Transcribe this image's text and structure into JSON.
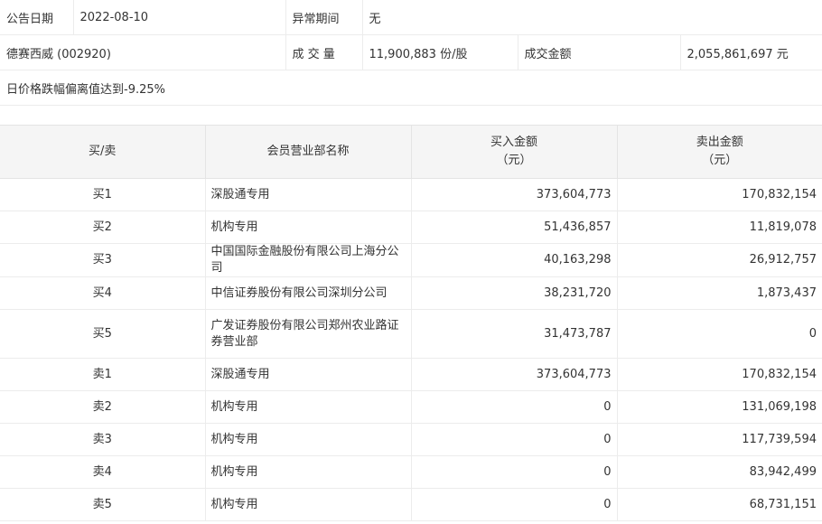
{
  "info": {
    "date_label": "公告日期",
    "date_value": "2022-08-10",
    "period_label": "异常期间",
    "period_value": "无",
    "stock": "德赛西威 (002920)",
    "volume_label": "成 交 量",
    "volume_value": "11,900,883 份/股",
    "amount_label": "成交金额",
    "amount_value": "2,055,861,697 元",
    "note": "日价格跌幅偏离值达到-9.25%"
  },
  "table": {
    "headers": {
      "side": "买/卖",
      "dept": "会员营业部名称",
      "buy_line1": "买入金额",
      "buy_line2": "（元）",
      "sell_line1": "卖出金额",
      "sell_line2": "（元）"
    },
    "rows": [
      {
        "side": "买1",
        "dept": "深股通专用",
        "buy": "373,604,773",
        "sell": "170,832,154"
      },
      {
        "side": "买2",
        "dept": "机构专用",
        "buy": "51,436,857",
        "sell": "11,819,078"
      },
      {
        "side": "买3",
        "dept": "中国国际金融股份有限公司上海分公司",
        "buy": "40,163,298",
        "sell": "26,912,757"
      },
      {
        "side": "买4",
        "dept": "中信证券股份有限公司深圳分公司",
        "buy": "38,231,720",
        "sell": "1,873,437"
      },
      {
        "side": "买5",
        "dept": "广发证券股份有限公司郑州农业路证券营业部",
        "buy": "31,473,787",
        "sell": "0"
      },
      {
        "side": "卖1",
        "dept": "深股通专用",
        "buy": "373,604,773",
        "sell": "170,832,154"
      },
      {
        "side": "卖2",
        "dept": "机构专用",
        "buy": "0",
        "sell": "131,069,198"
      },
      {
        "side": "卖3",
        "dept": "机构专用",
        "buy": "0",
        "sell": "117,739,594"
      },
      {
        "side": "卖4",
        "dept": "机构专用",
        "buy": "0",
        "sell": "83,942,499"
      },
      {
        "side": "卖5",
        "dept": "机构专用",
        "buy": "0",
        "sell": "68,731,151"
      }
    ]
  }
}
